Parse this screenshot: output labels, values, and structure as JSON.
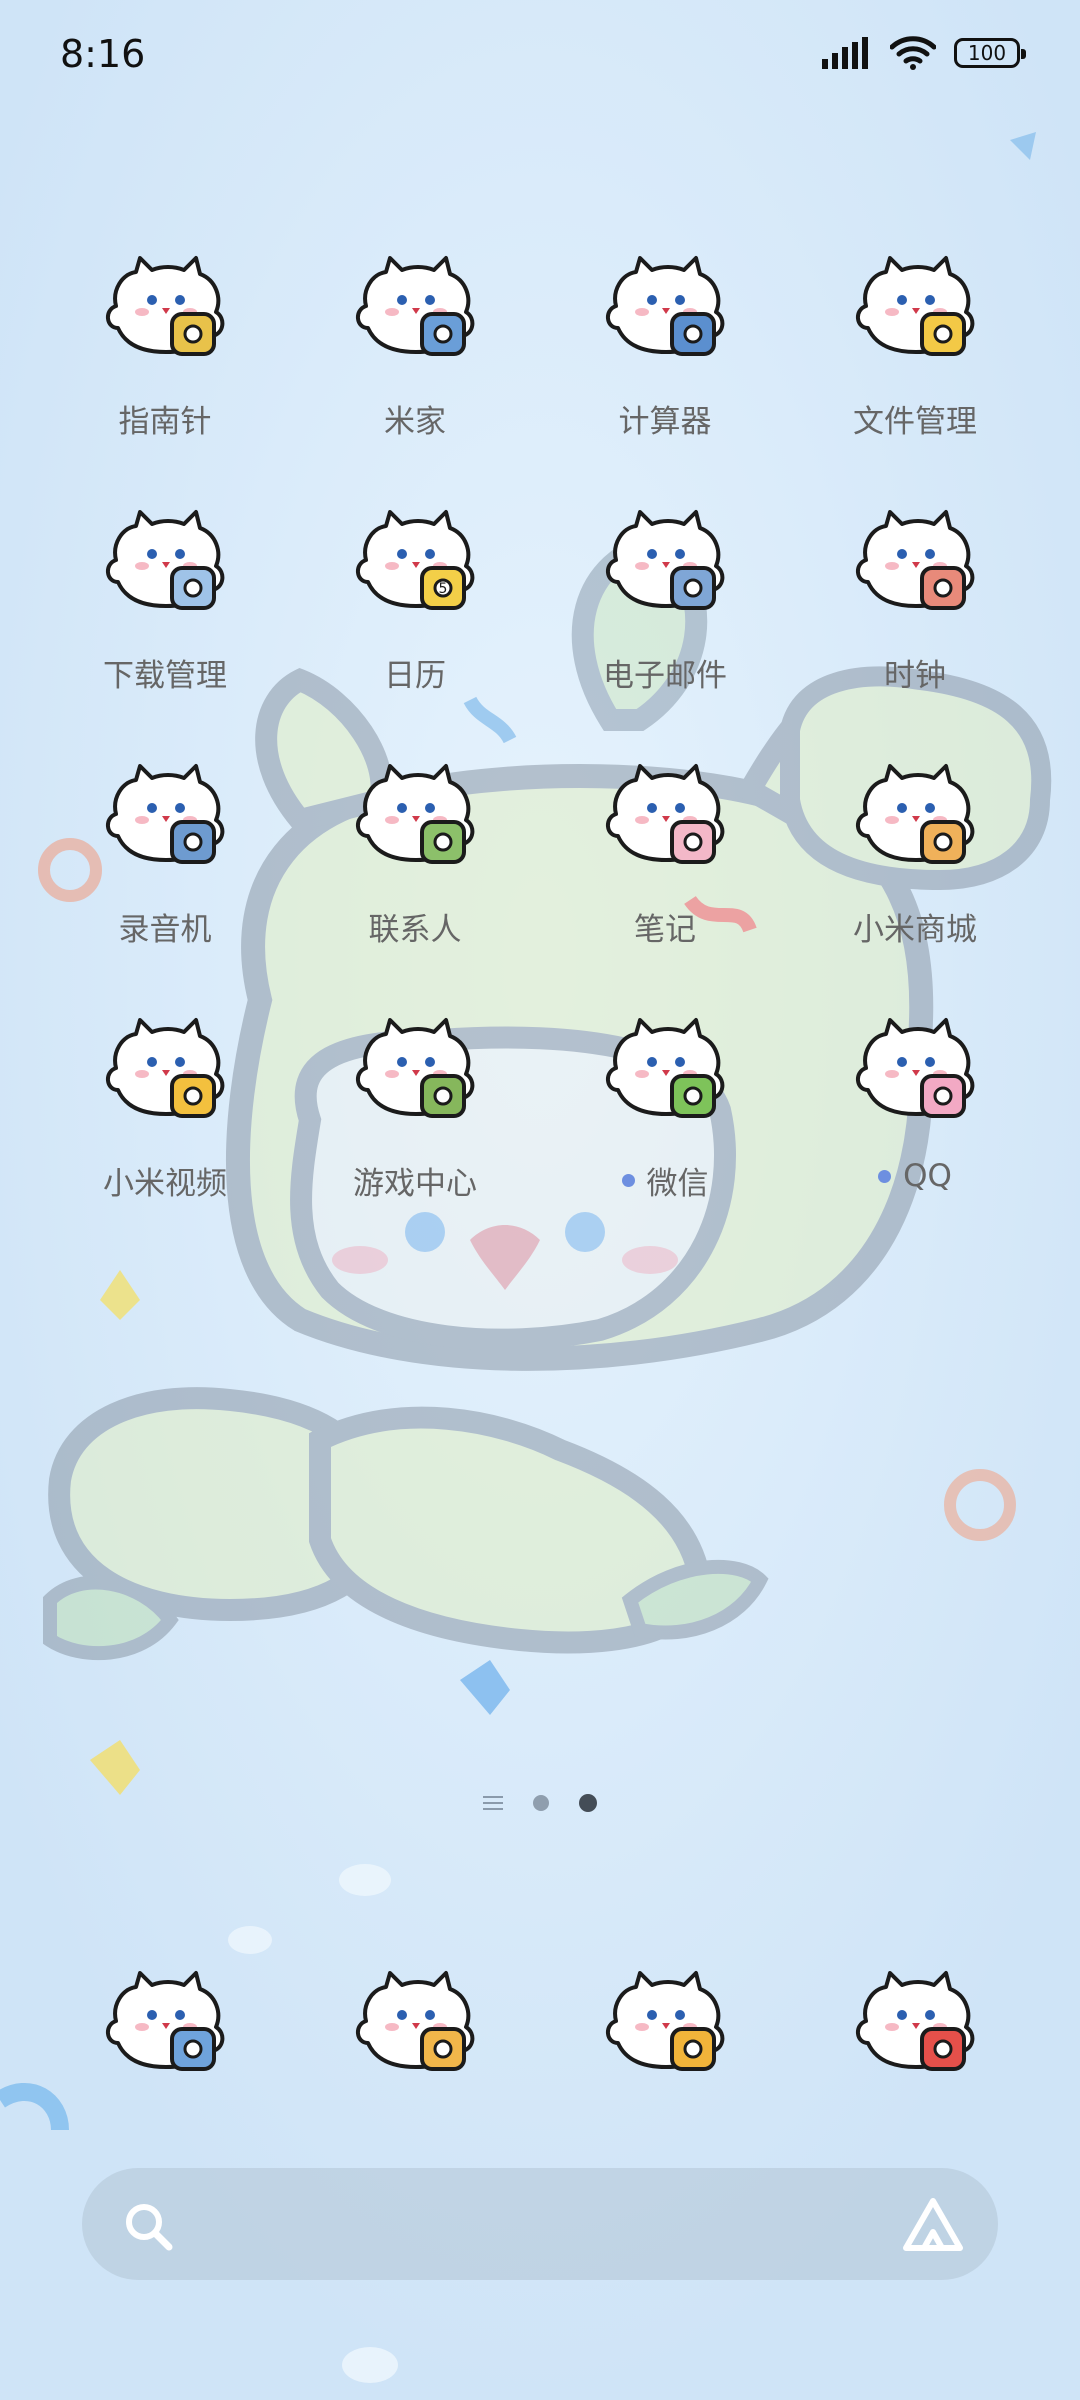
{
  "status_bar": {
    "time": "8:16",
    "battery": "100",
    "icons": [
      "signal-icon",
      "wifi-icon",
      "battery-icon"
    ]
  },
  "apps": [
    {
      "label": "指南针",
      "icon": "compass-icon",
      "accent": "#e8c24a"
    },
    {
      "label": "米家",
      "icon": "mijia-icon",
      "accent": "#6a9ed8"
    },
    {
      "label": "计算器",
      "icon": "calculator-icon",
      "accent": "#5b8fcf"
    },
    {
      "label": "文件管理",
      "icon": "folder-icon",
      "accent": "#f3c946"
    },
    {
      "label": "下载管理",
      "icon": "download-icon",
      "accent": "#9fc3e8"
    },
    {
      "label": "日历",
      "icon": "calendar-icon",
      "accent": "#f3cf48",
      "badge": "5"
    },
    {
      "label": "电子邮件",
      "icon": "mail-icon",
      "accent": "#7fa6d6"
    },
    {
      "label": "时钟",
      "icon": "clock-icon",
      "accent": "#e88a7a"
    },
    {
      "label": "录音机",
      "icon": "recorder-icon",
      "accent": "#6e9bd0"
    },
    {
      "label": "联系人",
      "icon": "contacts-icon",
      "accent": "#8cc06a"
    },
    {
      "label": "笔记",
      "icon": "notes-icon",
      "accent": "#f3b8c8"
    },
    {
      "label": "小米商城",
      "icon": "shopping-bag-icon",
      "accent": "#f0b15a"
    },
    {
      "label": "小米视频",
      "icon": "video-icon",
      "accent": "#f3c03e"
    },
    {
      "label": "游戏中心",
      "icon": "gamepad-icon",
      "accent": "#86b75c"
    },
    {
      "label": "微信",
      "icon": "wechat-icon",
      "accent": "#7ec35a",
      "dot": true
    },
    {
      "label": "QQ",
      "icon": "qq-penguin-icon",
      "accent": "#f2a9c4",
      "dot": true
    }
  ],
  "pager": {
    "pages": 2,
    "active": 2
  },
  "dock": [
    {
      "icon": "phone-icon",
      "accent": "#6fa3dc"
    },
    {
      "icon": "browser-icon",
      "accent": "#f1b64a"
    },
    {
      "icon": "messages-icon",
      "accent": "#f1b43a"
    },
    {
      "icon": "camera-icon",
      "accent": "#e5504a"
    }
  ],
  "search": {
    "left_icon": "search-icon",
    "right_icon": "assistant-icon"
  },
  "colors": {
    "dot": "#6d8fe0",
    "label": "#666666"
  }
}
